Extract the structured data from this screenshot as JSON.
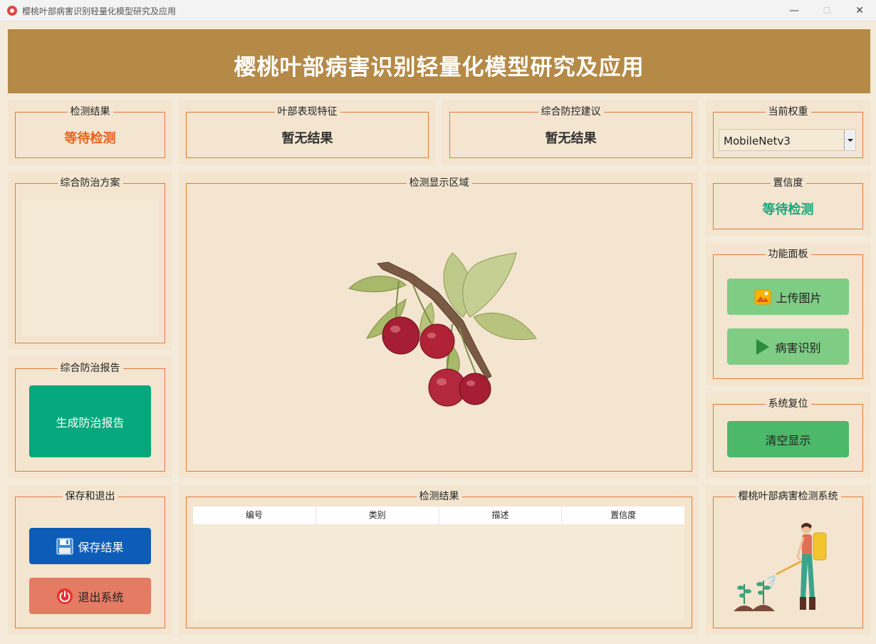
{
  "window": {
    "title": "樱桃叶部病害识别轻量化模型研究及应用",
    "minimize": "—",
    "maximize": "☐",
    "close": "✕"
  },
  "header": {
    "title": "樱桃叶部病害识别轻量化模型研究及应用"
  },
  "detection_result": {
    "label": "检测结果",
    "value": "等待检测",
    "color": "#e8601c"
  },
  "leaf_features": {
    "label": "叶部表现特征",
    "value": "暂无结果"
  },
  "control_advice": {
    "label": "综合防控建议",
    "value": "暂无结果"
  },
  "weights": {
    "label": "当前权重",
    "selected": "MobileNetv3"
  },
  "plan": {
    "label": "综合防治方案"
  },
  "display": {
    "label": "检测显示区域"
  },
  "confidence": {
    "label": "置信度",
    "value": "等待检测",
    "color": "#14a77a"
  },
  "functions": {
    "label": "功能面板",
    "upload": "上传图片",
    "identify": "病害识别"
  },
  "report": {
    "label": "综合防治报告",
    "generate": "生成防治报告"
  },
  "reset": {
    "label": "系统复位",
    "clear": "清空显示"
  },
  "save_exit": {
    "label": "保存和退出",
    "save": "保存结果",
    "exit": "退出系统"
  },
  "results_table": {
    "label": "检测结果",
    "columns": [
      "编号",
      "类别",
      "描述",
      "置信度"
    ]
  },
  "system": {
    "label": "樱桃叶部病害检测系统"
  },
  "colors": {
    "banner": "#b58946",
    "border": "#e07b3d",
    "green_btn": "#7fcc85",
    "clear_btn": "#4cb86a",
    "report_btn": "#05a87c",
    "save_btn": "#0d5db8",
    "exit_btn": "#e57b63"
  }
}
